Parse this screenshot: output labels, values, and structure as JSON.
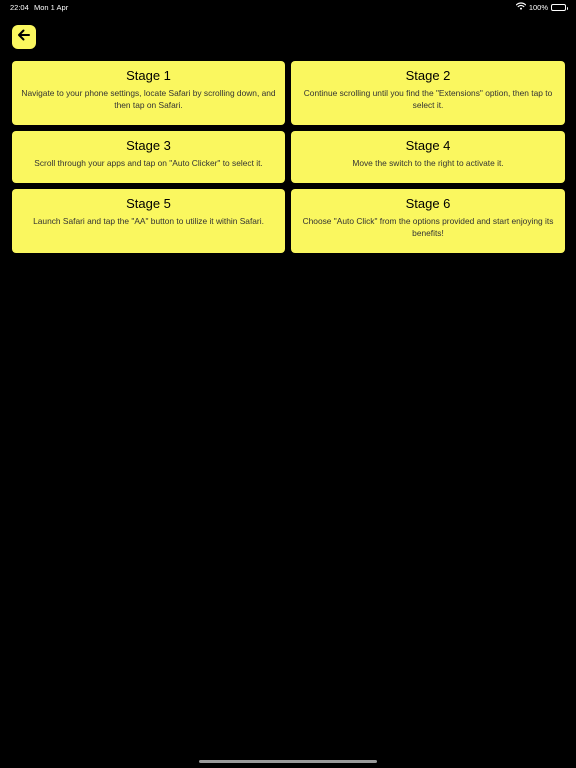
{
  "status_bar": {
    "time": "22:04",
    "date": "Mon 1 Apr",
    "battery": "100%"
  },
  "header": {
    "back_icon": "arrow-left-icon"
  },
  "stages": [
    {
      "title": "Stage 1",
      "text": "Navigate to your phone settings, locate Safari by scrolling down, and then tap on Safari."
    },
    {
      "title": "Stage 2",
      "text": "Continue scrolling until you find the \"Extensions\" option, then tap to select it."
    },
    {
      "title": "Stage 3",
      "text": "Scroll through your apps and tap on \"Auto Clicker\" to select it."
    },
    {
      "title": "Stage 4",
      "text": "Move the switch to the right to activate it."
    },
    {
      "title": "Stage 5",
      "text": "Launch Safari and tap the \"AA\" button to utilize it within Safari."
    },
    {
      "title": "Stage 6",
      "text": "Choose \"Auto Click\" from the options provided and start enjoying its benefits!"
    }
  ],
  "colors": {
    "background": "#000000",
    "card": "#faf75f",
    "card_title": "#000000",
    "card_text": "#333333"
  }
}
